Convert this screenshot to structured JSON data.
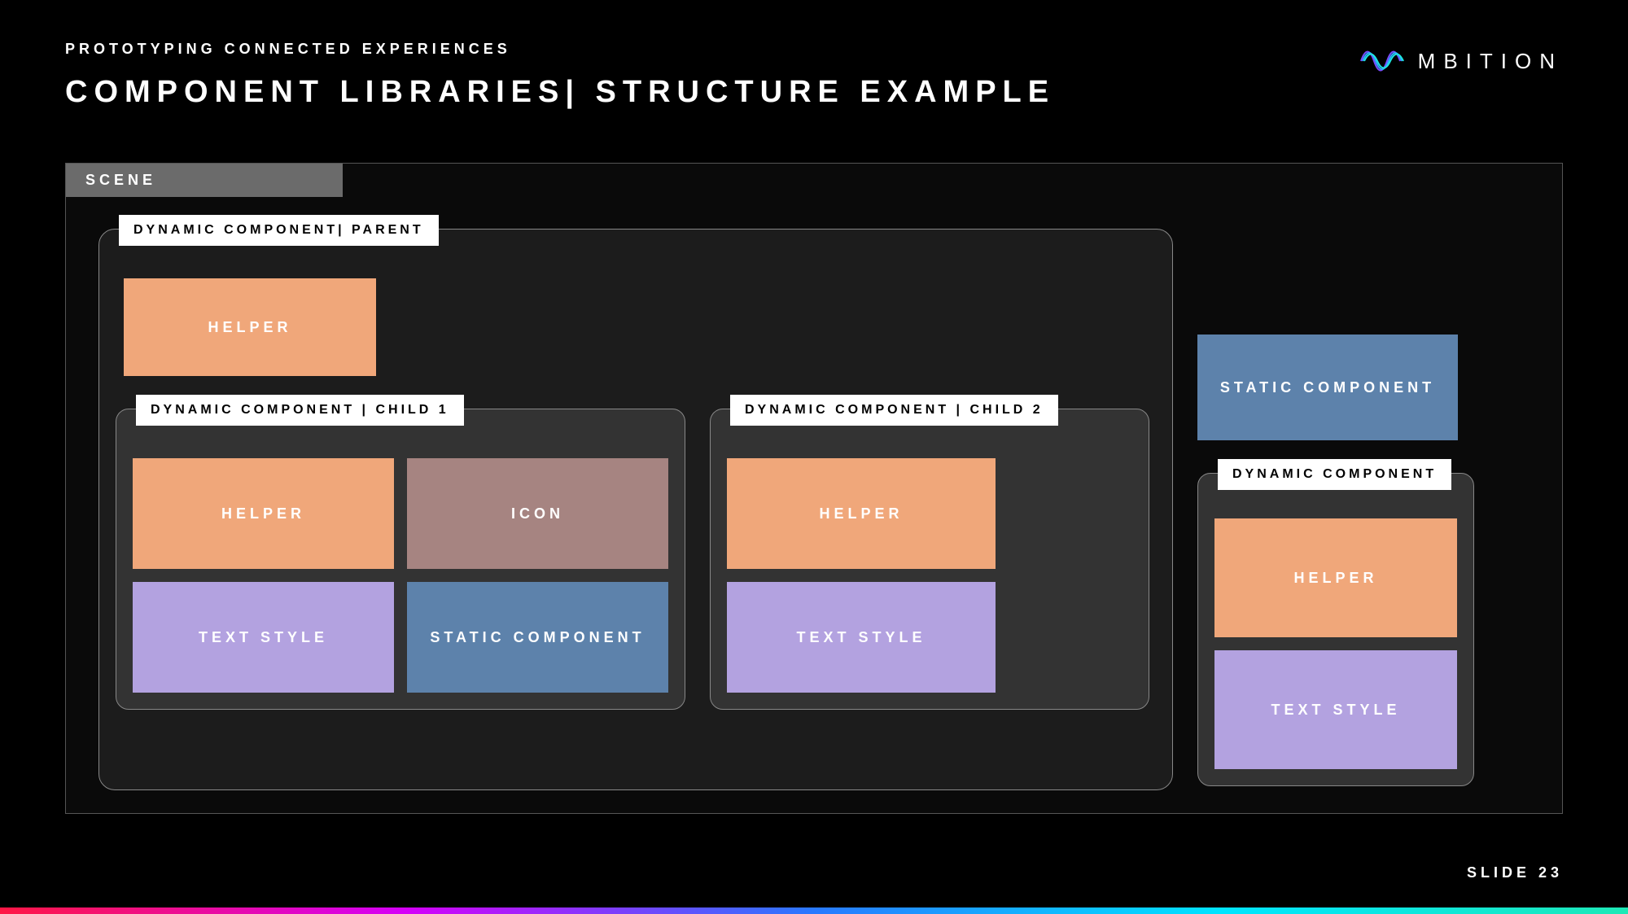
{
  "eyebrow": "PROTOTYPING CONNECTED EXPERIENCES",
  "title": "COMPONENT LIBRARIES| STRUCTURE EXAMPLE",
  "logo": {
    "text": "MBITION"
  },
  "scene": {
    "tab": "SCENE",
    "parent": {
      "label": "DYNAMIC COMPONENT| PARENT",
      "helper": "HELPER",
      "child1": {
        "label": "DYNAMIC COMPONENT | CHILD 1",
        "helper": "HELPER",
        "icon": "ICON",
        "textstyle": "TEXT STYLE",
        "static": "STATIC COMPONENT"
      },
      "child2": {
        "label": "DYNAMIC COMPONENT | CHILD 2",
        "helper": "HELPER",
        "textstyle": "TEXT STYLE"
      }
    },
    "rightStatic": "STATIC COMPONENT",
    "rightDyn": {
      "label": "DYNAMIC COMPONENT",
      "helper": "HELPER",
      "textstyle": "TEXT STYLE"
    }
  },
  "slideNum": "SLIDE 23"
}
